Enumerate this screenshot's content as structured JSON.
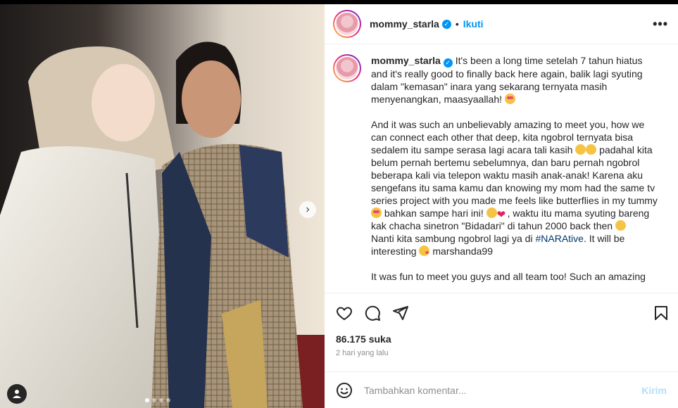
{
  "post": {
    "username": "mommy_starla",
    "separator": "•",
    "follow_label": "Ikuti",
    "more_label": "•••"
  },
  "caption": {
    "username": "mommy_starla",
    "p1": " It's been a long time setelah 7 tahun hiatus and it's really good to finally back here again, balik lagi syuting dalam \"kemasan\" inara yang sekarang ternyata masih menyenangkan, maasyaallah! ",
    "p2a": "And it was such an unbelievably amazing to meet you, how we can connect each other that deep, kita ngobrol ternyata bisa sedalem itu sampe serasa lagi acara tali kasih ",
    "p2b": " padahal kita belum pernah bertemu sebelumnya, dan baru pernah ngobrol beberapa kali via telepon waktu masih anak-anak! Karena aku sengefans itu sama kamu dan knowing my mom had the same tv series project with you made me feels like butterflies in my tummy ",
    "p2c": " bahkan sampe hari ini! ",
    "p2d": ", waktu itu mama syuting bareng kak chacha sinetron \"Bidadari\" di tahun 2000 back then ",
    "p3a": "Nanti kita sambung ngobrol lagi ya di ",
    "hashtag": "#NARAtive",
    "p3b": ". It will be interesting ",
    "p3c": " marshanda99",
    "p4": "It was fun to meet you guys and all team too! Such an amazing"
  },
  "stats": {
    "likes": "86.175 suka",
    "time": "2 hari yang lalu"
  },
  "comment": {
    "placeholder": "Tambahkan komentar...",
    "post_label": "Kirim"
  },
  "icons": [
    "heart-icon",
    "comment-icon",
    "share-icon",
    "bookmark-icon",
    "emoji-icon",
    "chevron-right-icon",
    "user-icon",
    "verified-icon"
  ],
  "colors": {
    "accent": "#0095f6",
    "hashtag": "#00376b",
    "text": "#262626",
    "muted": "#8e8e8e"
  }
}
